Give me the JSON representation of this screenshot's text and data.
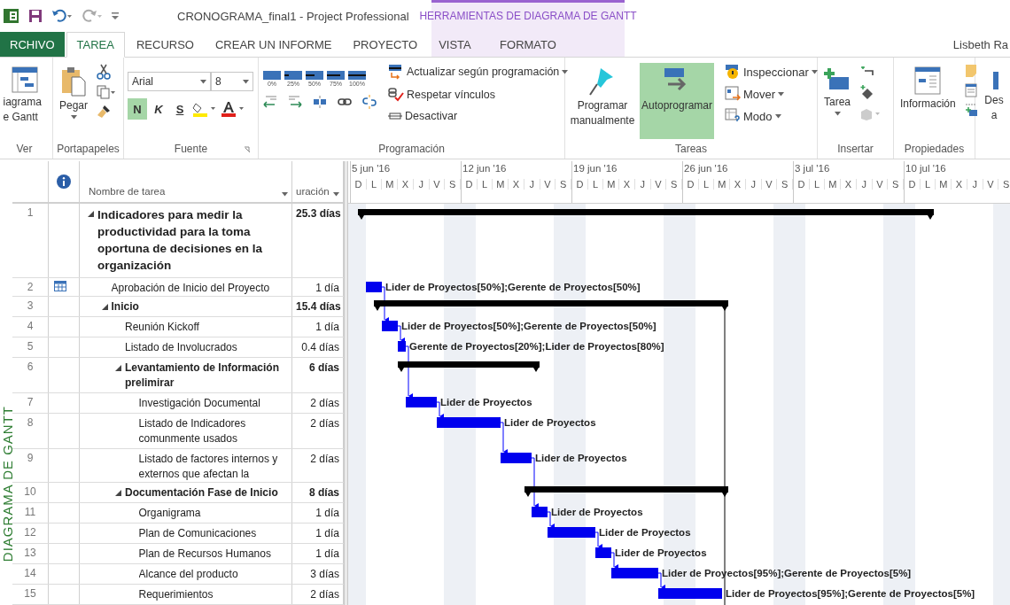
{
  "title_bar": {
    "title": "CRONOGRAMA_final1 - Project Professional",
    "context_group": "HERRAMIENTAS DE DIAGRAMA DE GANTT",
    "user": "Lisbeth Ra"
  },
  "tabs": [
    {
      "label": "RCHIVO",
      "kind": "file",
      "selected": false
    },
    {
      "label": "TAREA",
      "kind": "tab",
      "selected": true
    },
    {
      "label": "RECURSO",
      "kind": "tab",
      "selected": false
    },
    {
      "label": "CREAR UN INFORME",
      "kind": "tab",
      "selected": false
    },
    {
      "label": "PROYECTO",
      "kind": "tab",
      "selected": false
    },
    {
      "label": "VISTA",
      "kind": "tab",
      "selected": false
    },
    {
      "label": "FORMATO",
      "kind": "context",
      "selected": false
    }
  ],
  "ribbon": {
    "ver": {
      "label": "Ver",
      "button": "iagrama e Gantt"
    },
    "portapapeles": {
      "label": "Portapapeles",
      "paste": "Pegar"
    },
    "fuente": {
      "label": "Fuente",
      "font": "Arial",
      "size": "8",
      "styles": [
        {
          "label": "N",
          "selected": true
        },
        {
          "label": "K",
          "selected": false
        },
        {
          "label": "S",
          "selected": false
        }
      ]
    },
    "programacion": {
      "label": "Programación",
      "progress": [
        "0%",
        "25%",
        "50%",
        "75%",
        "100%"
      ],
      "commands": [
        "Actualizar según programación",
        "Respetar vínculos",
        "Desactivar"
      ]
    },
    "tareas": {
      "label": "Tareas",
      "modes": [
        {
          "label": "Programar manualmente",
          "selected": false
        },
        {
          "label": "Autoprogramar",
          "selected": true
        }
      ],
      "commands": [
        "Inspeccionar",
        "Mover",
        "Modo"
      ]
    },
    "insertar": {
      "label": "Insertar",
      "button": "Tarea"
    },
    "propiedades": {
      "label": "Propiedades",
      "button": "Información"
    },
    "cut_button": "Des a"
  },
  "side_label": "DIAGRAMA DE GANTT",
  "columns": [
    "Nombre de tarea",
    "uración"
  ],
  "timeline": [
    {
      "week": "5 jun '16",
      "days": [
        "D",
        "L",
        "M",
        "X",
        "J",
        "V",
        "S"
      ]
    },
    {
      "week": "12 jun '16",
      "days": [
        "D",
        "L",
        "M",
        "X",
        "J",
        "V",
        "S"
      ]
    },
    {
      "week": "19 jun '16",
      "days": [
        "D",
        "L",
        "M",
        "X",
        "J",
        "V",
        "S"
      ]
    },
    {
      "week": "26 jun '16",
      "days": [
        "D",
        "L",
        "M",
        "X",
        "J",
        "V",
        "S"
      ]
    },
    {
      "week": "3 jul '16",
      "days": [
        "D",
        "L",
        "M",
        "X",
        "J",
        "V",
        "S"
      ]
    },
    {
      "week": "10 jul '16",
      "days": [
        "D",
        "L",
        "M",
        "X",
        "J",
        "V",
        "S"
      ]
    }
  ],
  "tasks": [
    {
      "id": "1",
      "name": "Indicadores para medir la productividad para la toma oportuna de decisiones en la organización",
      "duration": "25.3 días",
      "indicator": false,
      "expanded": true,
      "children": [
        {
          "id": "2",
          "name": "Aprobación de Inicio del Proyecto",
          "duration": "1 día",
          "indicator": true,
          "resources": "Lider de Proyectos[50%];Gerente de Proyectos[50%]"
        },
        {
          "id": "3",
          "name": "Inicio",
          "duration": "15.4 días",
          "indicator": false,
          "expanded": true,
          "children": [
            {
              "id": "4",
              "name": "Reunión Kickoff",
              "duration": "1 día",
              "indicator": false,
              "resources": "Lider de Proyectos[50%];Gerente de Proyectos[50%]"
            },
            {
              "id": "5",
              "name": "Listado de Involucrados",
              "duration": "0.4 días",
              "indicator": false,
              "resources": "Gerente de Proyectos[20%];Lider de Proyectos[80%]"
            },
            {
              "id": "6",
              "name": "Levantamiento de Información prelimirar",
              "duration": "6 días",
              "indicator": false,
              "expanded": true,
              "children": [
                {
                  "id": "7",
                  "name": "Investigación Documental",
                  "duration": "2 días",
                  "indicator": false,
                  "resources": "Lider de Proyectos"
                },
                {
                  "id": "8",
                  "name": "Listado de Indicadores comunmente usados",
                  "duration": "2 días",
                  "indicator": false,
                  "resources": "Lider de Proyectos"
                },
                {
                  "id": "9",
                  "name": "Listado de factores internos y externos que afectan la",
                  "duration": "2 días",
                  "indicator": false,
                  "resources": "Lider de Proyectos"
                }
              ]
            },
            {
              "id": "10",
              "name": "Documentación Fase de Inicio",
              "duration": "8 días",
              "indicator": false,
              "expanded": true,
              "children": [
                {
                  "id": "11",
                  "name": "Organigrama",
                  "duration": "1 día",
                  "indicator": false,
                  "resources": "Lider de Proyectos"
                },
                {
                  "id": "12",
                  "name": "Plan de Comunicaciones",
                  "duration": "1 día",
                  "indicator": false,
                  "resources": "Lider de Proyectos"
                },
                {
                  "id": "13",
                  "name": "Plan de Recursos Humanos",
                  "duration": "1 día",
                  "indicator": false,
                  "resources": "Lider de Proyectos"
                },
                {
                  "id": "14",
                  "name": "Alcance del producto",
                  "duration": "3 días",
                  "indicator": false,
                  "resources": "Lider de Proyectos[95%];Gerente de Proyectos[5%]"
                },
                {
                  "id": "15",
                  "name": "Requerimientos",
                  "duration": "2 días",
                  "indicator": false,
                  "resources": "Lider de Proyectos[95%];Gerente de Proyectos[5%]"
                }
              ]
            }
          ]
        }
      ]
    }
  ]
}
